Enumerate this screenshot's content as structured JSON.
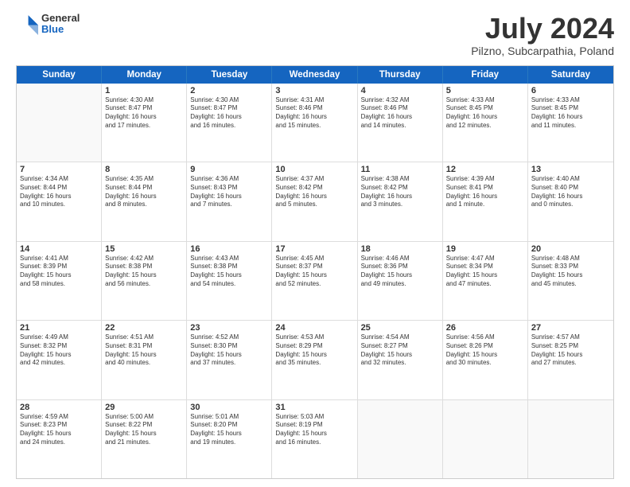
{
  "header": {
    "logo": {
      "general": "General",
      "blue": "Blue"
    },
    "title": "July 2024",
    "location": "Pilzno, Subcarpathia, Poland"
  },
  "days_of_week": [
    "Sunday",
    "Monday",
    "Tuesday",
    "Wednesday",
    "Thursday",
    "Friday",
    "Saturday"
  ],
  "weeks": [
    [
      {
        "day": "",
        "info": ""
      },
      {
        "day": "1",
        "info": "Sunrise: 4:30 AM\nSunset: 8:47 PM\nDaylight: 16 hours\nand 17 minutes."
      },
      {
        "day": "2",
        "info": "Sunrise: 4:30 AM\nSunset: 8:47 PM\nDaylight: 16 hours\nand 16 minutes."
      },
      {
        "day": "3",
        "info": "Sunrise: 4:31 AM\nSunset: 8:46 PM\nDaylight: 16 hours\nand 15 minutes."
      },
      {
        "day": "4",
        "info": "Sunrise: 4:32 AM\nSunset: 8:46 PM\nDaylight: 16 hours\nand 14 minutes."
      },
      {
        "day": "5",
        "info": "Sunrise: 4:33 AM\nSunset: 8:45 PM\nDaylight: 16 hours\nand 12 minutes."
      },
      {
        "day": "6",
        "info": "Sunrise: 4:33 AM\nSunset: 8:45 PM\nDaylight: 16 hours\nand 11 minutes."
      }
    ],
    [
      {
        "day": "7",
        "info": "Sunrise: 4:34 AM\nSunset: 8:44 PM\nDaylight: 16 hours\nand 10 minutes."
      },
      {
        "day": "8",
        "info": "Sunrise: 4:35 AM\nSunset: 8:44 PM\nDaylight: 16 hours\nand 8 minutes."
      },
      {
        "day": "9",
        "info": "Sunrise: 4:36 AM\nSunset: 8:43 PM\nDaylight: 16 hours\nand 7 minutes."
      },
      {
        "day": "10",
        "info": "Sunrise: 4:37 AM\nSunset: 8:42 PM\nDaylight: 16 hours\nand 5 minutes."
      },
      {
        "day": "11",
        "info": "Sunrise: 4:38 AM\nSunset: 8:42 PM\nDaylight: 16 hours\nand 3 minutes."
      },
      {
        "day": "12",
        "info": "Sunrise: 4:39 AM\nSunset: 8:41 PM\nDaylight: 16 hours\nand 1 minute."
      },
      {
        "day": "13",
        "info": "Sunrise: 4:40 AM\nSunset: 8:40 PM\nDaylight: 16 hours\nand 0 minutes."
      }
    ],
    [
      {
        "day": "14",
        "info": "Sunrise: 4:41 AM\nSunset: 8:39 PM\nDaylight: 15 hours\nand 58 minutes."
      },
      {
        "day": "15",
        "info": "Sunrise: 4:42 AM\nSunset: 8:38 PM\nDaylight: 15 hours\nand 56 minutes."
      },
      {
        "day": "16",
        "info": "Sunrise: 4:43 AM\nSunset: 8:38 PM\nDaylight: 15 hours\nand 54 minutes."
      },
      {
        "day": "17",
        "info": "Sunrise: 4:45 AM\nSunset: 8:37 PM\nDaylight: 15 hours\nand 52 minutes."
      },
      {
        "day": "18",
        "info": "Sunrise: 4:46 AM\nSunset: 8:36 PM\nDaylight: 15 hours\nand 49 minutes."
      },
      {
        "day": "19",
        "info": "Sunrise: 4:47 AM\nSunset: 8:34 PM\nDaylight: 15 hours\nand 47 minutes."
      },
      {
        "day": "20",
        "info": "Sunrise: 4:48 AM\nSunset: 8:33 PM\nDaylight: 15 hours\nand 45 minutes."
      }
    ],
    [
      {
        "day": "21",
        "info": "Sunrise: 4:49 AM\nSunset: 8:32 PM\nDaylight: 15 hours\nand 42 minutes."
      },
      {
        "day": "22",
        "info": "Sunrise: 4:51 AM\nSunset: 8:31 PM\nDaylight: 15 hours\nand 40 minutes."
      },
      {
        "day": "23",
        "info": "Sunrise: 4:52 AM\nSunset: 8:30 PM\nDaylight: 15 hours\nand 37 minutes."
      },
      {
        "day": "24",
        "info": "Sunrise: 4:53 AM\nSunset: 8:29 PM\nDaylight: 15 hours\nand 35 minutes."
      },
      {
        "day": "25",
        "info": "Sunrise: 4:54 AM\nSunset: 8:27 PM\nDaylight: 15 hours\nand 32 minutes."
      },
      {
        "day": "26",
        "info": "Sunrise: 4:56 AM\nSunset: 8:26 PM\nDaylight: 15 hours\nand 30 minutes."
      },
      {
        "day": "27",
        "info": "Sunrise: 4:57 AM\nSunset: 8:25 PM\nDaylight: 15 hours\nand 27 minutes."
      }
    ],
    [
      {
        "day": "28",
        "info": "Sunrise: 4:59 AM\nSunset: 8:23 PM\nDaylight: 15 hours\nand 24 minutes."
      },
      {
        "day": "29",
        "info": "Sunrise: 5:00 AM\nSunset: 8:22 PM\nDaylight: 15 hours\nand 21 minutes."
      },
      {
        "day": "30",
        "info": "Sunrise: 5:01 AM\nSunset: 8:20 PM\nDaylight: 15 hours\nand 19 minutes."
      },
      {
        "day": "31",
        "info": "Sunrise: 5:03 AM\nSunset: 8:19 PM\nDaylight: 15 hours\nand 16 minutes."
      },
      {
        "day": "",
        "info": ""
      },
      {
        "day": "",
        "info": ""
      },
      {
        "day": "",
        "info": ""
      }
    ]
  ]
}
